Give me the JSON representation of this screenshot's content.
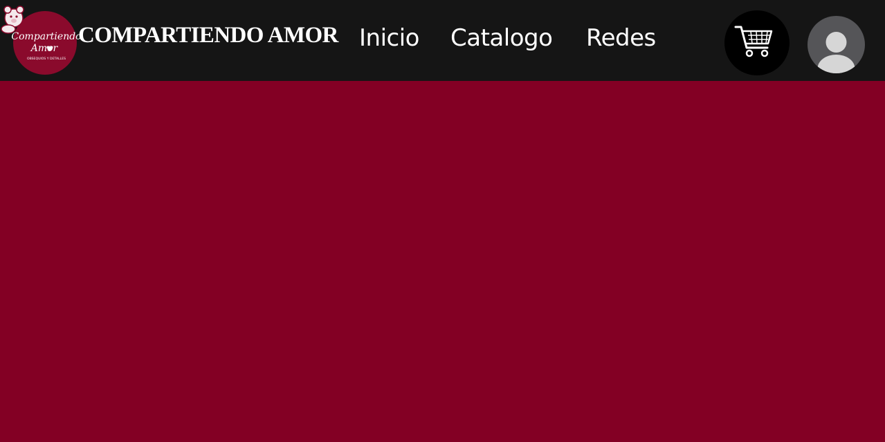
{
  "colors": {
    "navbar_bg": "#151515",
    "main_bg": "#830024",
    "logo_circle": "#8a0a2c",
    "text": "#ffffff",
    "cart_bg": "#000000",
    "avatar_bg": "#555558",
    "avatar_figure": "#d6d6d6"
  },
  "logo": {
    "line1": "Compartiendo",
    "line2": "Amor",
    "tagline": "OBSEQUIOS Y DETALLES",
    "icons": [
      "teddy-bear-icon",
      "heart-icon"
    ]
  },
  "brand": {
    "title": "COMPARTIENDO AMOR"
  },
  "nav": {
    "items": [
      {
        "label": "Inicio"
      },
      {
        "label": "Catalogo"
      },
      {
        "label": "Redes"
      }
    ],
    "active_index": 0
  },
  "actions": {
    "cart_icon": "shopping-cart-icon",
    "avatar_icon": "user-avatar-icon"
  }
}
